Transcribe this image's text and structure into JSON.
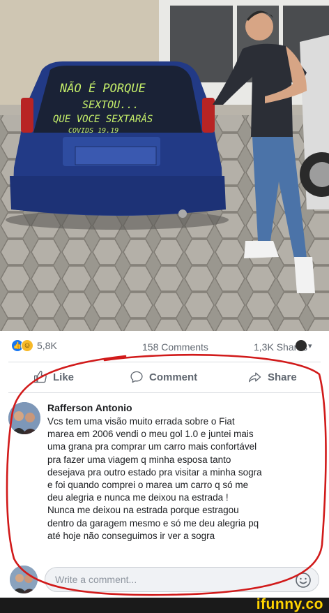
{
  "photo": {
    "window_text": {
      "line1": "NÃO É PORQUE",
      "line2": "SEXTOU...",
      "line3": "QUE VOCE SEXTARÁS",
      "line4": "COVIDS 19.19"
    }
  },
  "stats": {
    "reactions_count": "5,8K",
    "comments_count": "158 Comments",
    "shares_count": "1,3K Shares"
  },
  "actions": {
    "like_label": "Like",
    "comment_label": "Comment",
    "share_label": "Share"
  },
  "comment": {
    "author": "Rafferson Antonio",
    "text": "Vcs tem uma visão muito errada sobre o Fiat\nmarea em 2006 vendi o meu gol 1.0 e juntei mais\numa grana pra comprar um carro mais confortável\npra fazer uma viagem q minha esposa tanto\ndesejava pra outro estado pra visitar a minha sogra\ne foi quando comprei o marea um carro q só me\ndeu alegria e nunca me deixou na estrada !\nNunca me deixou na estrada porque estragou\ndentro da garagem mesmo e só me deu alegria pq\naté hoje não conseguimos ir ver a sogra"
  },
  "write_comment": {
    "placeholder": "Write a comment..."
  },
  "watermark": {
    "text": "ifunny.co"
  },
  "colors": {
    "facebook_blue": "#1877f2",
    "annotation_red": "#d11a1a",
    "watermark_yellow": "#ffd400"
  },
  "icons": [
    "like-reaction-icon",
    "haha-reaction-icon",
    "thumbs-up-icon",
    "comment-icon",
    "share-icon",
    "emoji-icon",
    "chevron-down-icon"
  ]
}
